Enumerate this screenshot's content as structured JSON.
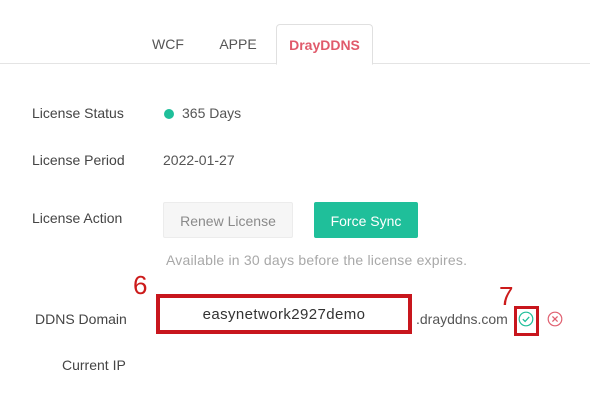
{
  "tabs": [
    {
      "label": "WCF"
    },
    {
      "label": "APPE"
    },
    {
      "label": "DrayDDNS",
      "active": true
    }
  ],
  "license": {
    "status_label": "License Status",
    "status_value": "365 Days",
    "period_label": "License Period",
    "period_value": "2022-01-27",
    "action_label": "License Action",
    "renew_button": "Renew License",
    "force_sync_button": "Force Sync",
    "hint": "Available in 30 days before the license expires."
  },
  "ddns": {
    "domain_label": "DDNS Domain",
    "domain_value": "easynetwork2927demo",
    "domain_suffix": ".drayddns.com",
    "current_ip_label": "Current IP"
  },
  "annotations": {
    "step_domain": "6",
    "step_confirm": "7"
  },
  "colors": {
    "accent_teal": "#1fbf9a",
    "active_tab_text": "#e05a6b",
    "annotation_red": "#c8161d",
    "cancel_red": "#e06070"
  },
  "icons": {
    "confirm": "check-circle-icon",
    "cancel": "close-circle-icon"
  }
}
